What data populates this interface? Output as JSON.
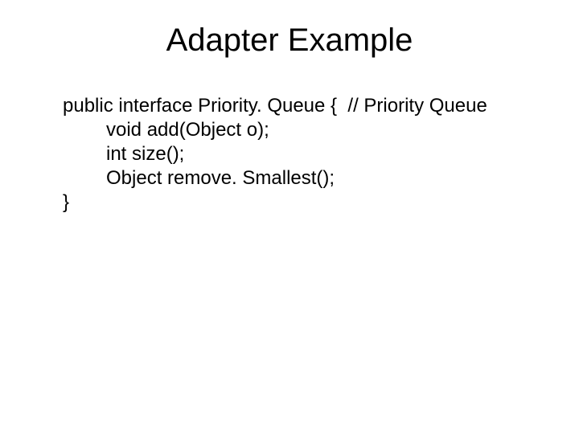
{
  "title": "Adapter Example",
  "code": {
    "line1": "public interface Priority. Queue {  // Priority Queue",
    "line2": "void add(Object o);",
    "line3": "int size();",
    "line4": "Object remove. Smallest();",
    "line5": "}"
  }
}
